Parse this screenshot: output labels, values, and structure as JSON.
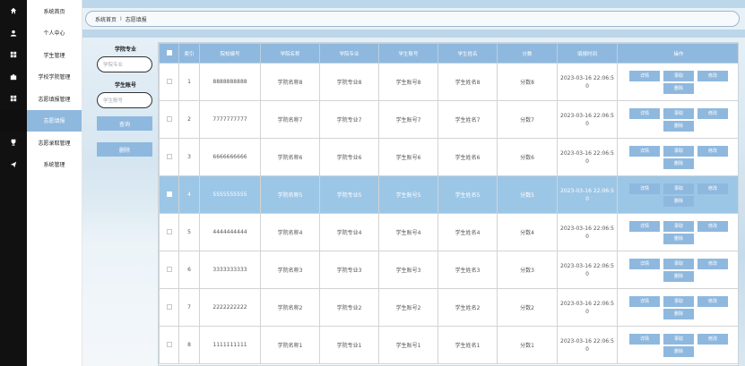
{
  "rail_icons": [
    "home-icon",
    "user-icon",
    "grid-icon",
    "briefcase-icon",
    "grid-icon",
    "",
    "trophy-icon",
    "send-icon"
  ],
  "sidebar": {
    "items": [
      {
        "label": "系统首页"
      },
      {
        "label": "个人中心"
      },
      {
        "label": "学生管理"
      },
      {
        "label": "学校学院管理"
      },
      {
        "label": "志愿填报管理"
      },
      {
        "label": "志愿填报"
      },
      {
        "label": "志愿录取管理"
      },
      {
        "label": "系统管理"
      }
    ],
    "active_index": 5
  },
  "breadcrumb": {
    "home": "系统首页",
    "separator": "I",
    "current": "志愿填报"
  },
  "search": {
    "major_label": "学院专业",
    "major_placeholder": "学院专业",
    "account_label": "学生账号",
    "account_placeholder": "学生账号",
    "query_button": "查询",
    "delete_button": "删除"
  },
  "table": {
    "headers": [
      "索引",
      "院校编号",
      "学院名称",
      "学院专业",
      "学生账号",
      "学生姓名",
      "分数",
      "填报时间",
      "操作"
    ],
    "action_labels": {
      "detail": "详情",
      "admit": "录取",
      "edit": "修改",
      "delete": "删除"
    },
    "selected_row": 3,
    "rows": [
      {
        "index": "1",
        "code": "8888888888",
        "college": "学院名称8",
        "major": "学院专业8",
        "account": "学生账号8",
        "name": "学生姓名8",
        "score": "分数8",
        "time1": "2023-03-16 22:06:5",
        "time2": "0"
      },
      {
        "index": "2",
        "code": "7777777777",
        "college": "学院名称7",
        "major": "学院专业7",
        "account": "学生账号7",
        "name": "学生姓名7",
        "score": "分数7",
        "time1": "2023-03-16 22:06:5",
        "time2": "0"
      },
      {
        "index": "3",
        "code": "6666666666",
        "college": "学院名称6",
        "major": "学院专业6",
        "account": "学生账号6",
        "name": "学生姓名6",
        "score": "分数6",
        "time1": "2023-03-16 22:06:5",
        "time2": "0"
      },
      {
        "index": "4",
        "code": "5555555555",
        "college": "学院名称5",
        "major": "学院专业5",
        "account": "学生账号5",
        "name": "学生姓名5",
        "score": "分数5",
        "time1": "2023-03-16 22:06:5",
        "time2": "0"
      },
      {
        "index": "5",
        "code": "4444444444",
        "college": "学院名称4",
        "major": "学院专业4",
        "account": "学生账号4",
        "name": "学生姓名4",
        "score": "分数4",
        "time1": "2023-03-16 22:06:5",
        "time2": "0"
      },
      {
        "index": "6",
        "code": "3333333333",
        "college": "学院名称3",
        "major": "学院专业3",
        "account": "学生账号3",
        "name": "学生姓名3",
        "score": "分数3",
        "time1": "2023-03-16 22:06:5",
        "time2": "0"
      },
      {
        "index": "7",
        "code": "2222222222",
        "college": "学院名称2",
        "major": "学院专业2",
        "account": "学生账号2",
        "name": "学生姓名2",
        "score": "分数2",
        "time1": "2023-03-16 22:06:5",
        "time2": "0"
      },
      {
        "index": "8",
        "code": "1111111111",
        "college": "学院名称1",
        "major": "学院专业1",
        "account": "学生账号1",
        "name": "学生姓名1",
        "score": "分数1",
        "time1": "2023-03-16 22:06:5",
        "time2": "0"
      }
    ]
  },
  "colors": {
    "accent": "#8fb8de",
    "selected_row": "#9cc6e6",
    "rail": "#111111"
  }
}
